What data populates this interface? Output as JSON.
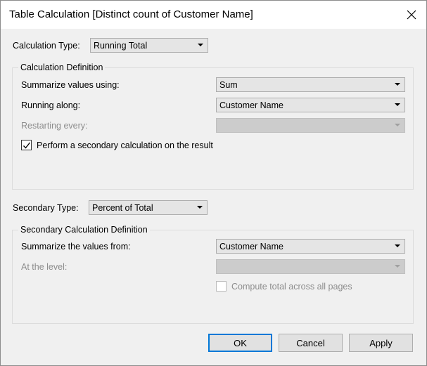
{
  "window": {
    "title": "Table Calculation [Distinct count of Customer Name]"
  },
  "calculation_type": {
    "label": "Calculation Type:",
    "value": "Running Total"
  },
  "calculation_definition": {
    "title": "Calculation Definition",
    "summarize": {
      "label": "Summarize values using:",
      "value": "Sum"
    },
    "running_along": {
      "label": "Running along:",
      "value": "Customer Name"
    },
    "restarting_every": {
      "label": "Restarting every:",
      "value": ""
    },
    "secondary_calc": {
      "label": "Perform a secondary calculation on the result",
      "checked": true
    }
  },
  "secondary_type": {
    "label": "Secondary Type:",
    "value": "Percent of Total"
  },
  "secondary_definition": {
    "title": "Secondary Calculation Definition",
    "summarize_from": {
      "label": "Summarize the values from:",
      "value": "Customer Name"
    },
    "at_level": {
      "label": "At the level:",
      "value": ""
    },
    "compute_total": {
      "label": "Compute total across all pages",
      "checked": false
    }
  },
  "buttons": {
    "ok": "OK",
    "cancel": "Cancel",
    "apply": "Apply"
  },
  "colors": {
    "accent": "#0078d7",
    "dialog_bg": "#f0f0f0",
    "disabled_text": "#8d8d8d"
  }
}
